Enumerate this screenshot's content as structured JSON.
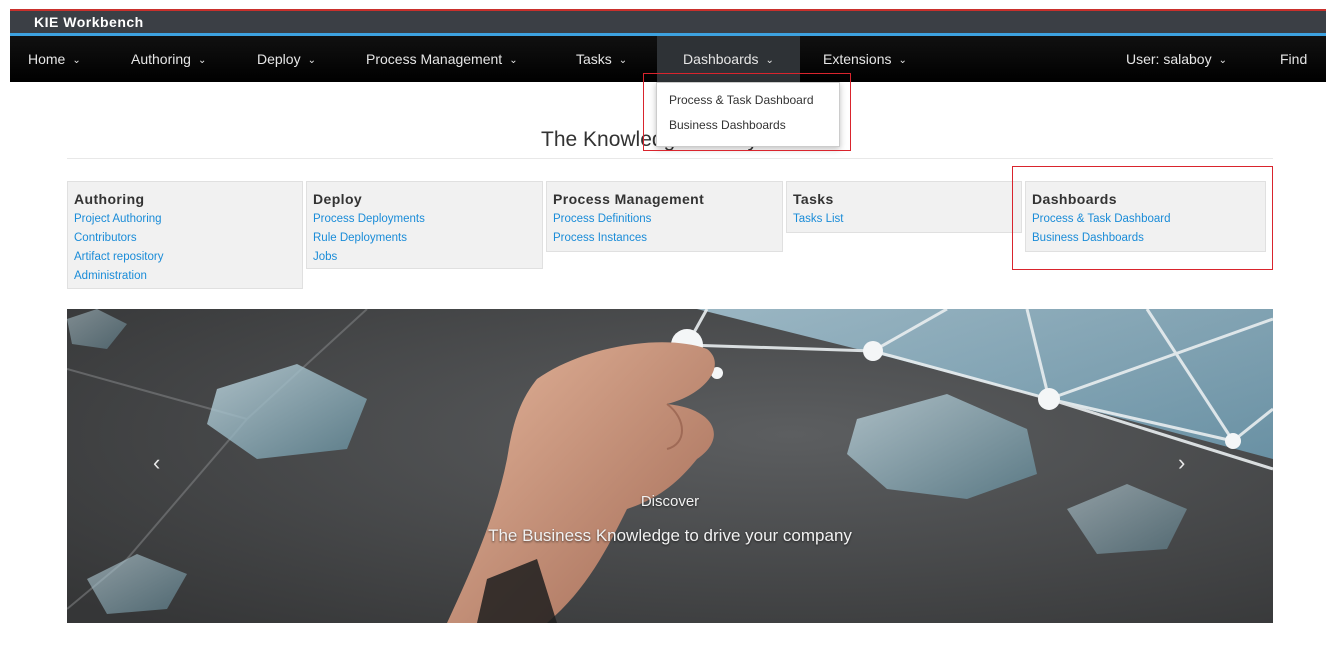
{
  "brand": {
    "title": "KIE Workbench"
  },
  "nav": {
    "items": [
      {
        "label": "Home"
      },
      {
        "label": "Authoring"
      },
      {
        "label": "Deploy"
      },
      {
        "label": "Process Management"
      },
      {
        "label": "Tasks"
      },
      {
        "label": "Dashboards"
      },
      {
        "label": "Extensions"
      }
    ],
    "user": "User: salaboy",
    "find": "Find",
    "chevron": "⌄"
  },
  "dropdown": {
    "items": [
      "Process & Task Dashboard",
      "Business Dashboards"
    ]
  },
  "page": {
    "title": "The Knowledge Life Cycle"
  },
  "cards": [
    {
      "title": "Authoring",
      "links": [
        "Project Authoring",
        "Contributors",
        "Artifact repository",
        "Administration"
      ]
    },
    {
      "title": "Deploy",
      "links": [
        "Process Deployments",
        "Rule Deployments",
        "Jobs"
      ]
    },
    {
      "title": "Process Management",
      "links": [
        "Process Definitions",
        "Process Instances"
      ]
    },
    {
      "title": "Tasks",
      "links": [
        "Tasks List"
      ]
    },
    {
      "title": "Dashboards",
      "links": [
        "Process & Task Dashboard",
        "Business Dashboards"
      ]
    }
  ],
  "carousel": {
    "prev": "‹",
    "next": "›",
    "caption_heading": "Discover",
    "caption_text": "The Business Knowledge to drive your company"
  },
  "colors": {
    "brand_bar": "#3b3f45",
    "accent_blue": "#3da2e0",
    "nav_bg": "#000000",
    "link": "#1a8cd8",
    "highlight": "#d9242d"
  }
}
